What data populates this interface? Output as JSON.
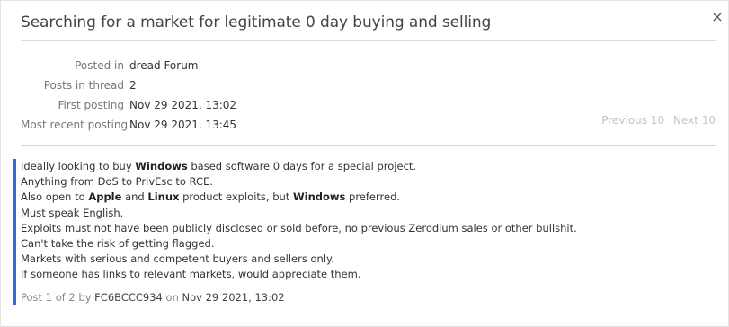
{
  "dialog": {
    "title": "Searching for a market for legitimate 0 day buying and selling",
    "close_label": "×"
  },
  "meta": [
    {
      "label": "Posted in",
      "value": "dread Forum"
    },
    {
      "label": "Posts in thread",
      "value": "2"
    },
    {
      "label": "First posting",
      "value": "Nov 29 2021, 13:02"
    },
    {
      "label": "Most recent posting",
      "value": "Nov 29 2021, 13:45"
    }
  ],
  "pager": {
    "previous": "Previous 10",
    "next": "Next 10"
  },
  "post": {
    "lines": [
      [
        {
          "t": "Ideally looking to buy "
        },
        {
          "t": "Windows",
          "b": true
        },
        {
          "t": " based software 0 days for a special project."
        }
      ],
      [
        {
          "t": "Anything from DoS to PrivEsc to RCE."
        }
      ],
      [
        {
          "t": "Also open to "
        },
        {
          "t": "Apple",
          "b": true
        },
        {
          "t": " and "
        },
        {
          "t": "Linux",
          "b": true
        },
        {
          "t": " product exploits, but "
        },
        {
          "t": "Windows",
          "b": true
        },
        {
          "t": " preferred."
        }
      ],
      [
        {
          "t": "Must speak English."
        }
      ],
      [
        {
          "t": "Exploits must not have been publicly disclosed or sold before, no previous Zerodium sales or other bullshit."
        }
      ],
      [
        {
          "t": "Can't take the risk of getting flagged."
        }
      ],
      [
        {
          "t": "Markets with serious and competent buyers and sellers only."
        }
      ],
      [
        {
          "t": "If someone has links to relevant markets, would appreciate them."
        }
      ]
    ],
    "footer": {
      "prefix": "Post 1 of 2 by ",
      "author": "FC6BCCC934",
      "on": " on ",
      "date": "Nov 29 2021, 13:02"
    }
  },
  "colors": {
    "accent": "#2b6fd6",
    "muted": "#c4c4c4"
  }
}
